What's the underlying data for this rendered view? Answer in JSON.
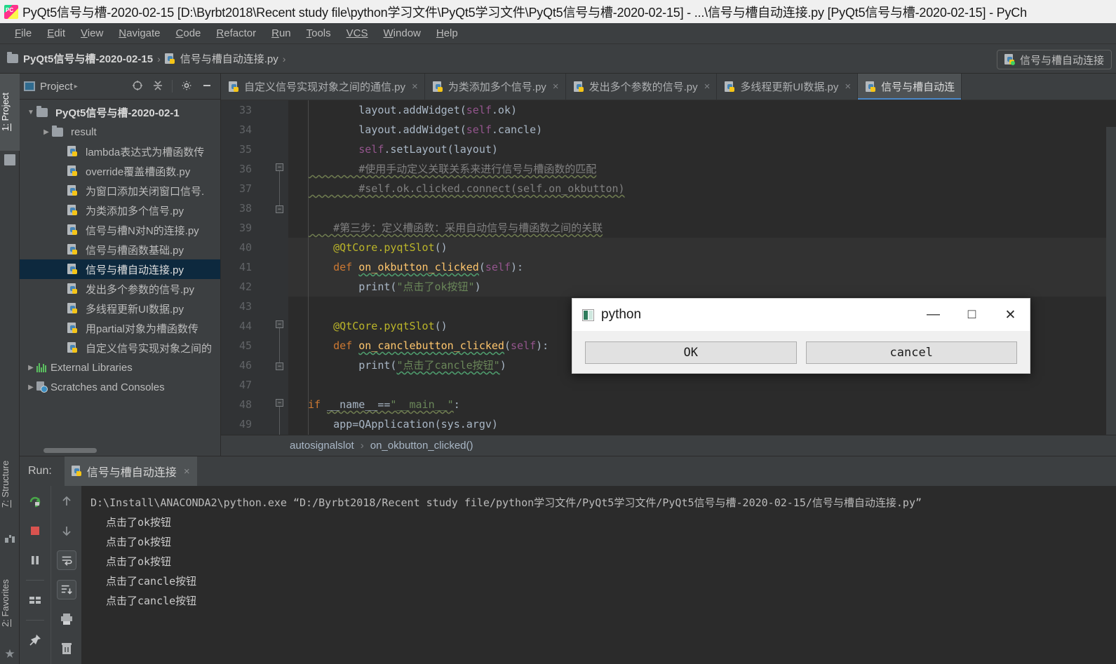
{
  "window": {
    "title": "PyQt5信号与槽-2020-02-15 [D:\\Byrbt2018\\Recent study file\\python学习文件\\PyQt5学习文件\\PyQt5信号与槽-2020-02-15] - ...\\信号与槽自动连接.py [PyQt5信号与槽-2020-02-15] - PyCh",
    "app_icon": "pycharm-logo-icon"
  },
  "menubar": {
    "items": [
      {
        "pre": "F",
        "rest": "ile"
      },
      {
        "pre": "E",
        "rest": "dit"
      },
      {
        "pre": "V",
        "rest": "iew"
      },
      {
        "pre": "N",
        "rest": "avigate"
      },
      {
        "pre": "C",
        "rest": "ode"
      },
      {
        "pre": "R",
        "rest": "efactor"
      },
      {
        "pre": "R",
        "rest": "un"
      },
      {
        "pre": "T",
        "rest": "ools"
      },
      {
        "pre": "VCS",
        "rest": ""
      },
      {
        "pre": "W",
        "rest": "indow"
      },
      {
        "pre": "H",
        "rest": "elp"
      }
    ]
  },
  "navbar": {
    "crumbs": [
      "PyQt5信号与槽-2020-02-15",
      "信号与槽自动连接.py"
    ],
    "separator": "›",
    "run_config": "信号与槽自动连接"
  },
  "left_strip": {
    "project_tab": {
      "num": "1:",
      "label": " Project"
    },
    "structure_tab": {
      "num": "7:",
      "label": " Structure"
    },
    "favorites_tab": {
      "num": "2:",
      "label": " Favorites"
    }
  },
  "project_panel": {
    "title": "Project",
    "caret": "▸",
    "tools": [
      "locate-icon",
      "collapse-all-icon",
      "gear-icon",
      "hide-icon"
    ],
    "tree": [
      {
        "indent": 0,
        "twisty": "▼",
        "icon": "folder",
        "label": "PyQt5信号与槽-2020-02-1",
        "root": true,
        "selected": false
      },
      {
        "indent": 1,
        "twisty": "▶",
        "icon": "folder",
        "label": "result",
        "root": false,
        "selected": false
      },
      {
        "indent": 2,
        "twisty": "",
        "icon": "py",
        "label": "lambda表达式为槽函数传",
        "root": false,
        "selected": false
      },
      {
        "indent": 2,
        "twisty": "",
        "icon": "py",
        "label": "override覆盖槽函数.py",
        "root": false,
        "selected": false
      },
      {
        "indent": 2,
        "twisty": "",
        "icon": "py",
        "label": "为窗口添加关闭窗口信号.",
        "root": false,
        "selected": false
      },
      {
        "indent": 2,
        "twisty": "",
        "icon": "py",
        "label": "为类添加多个信号.py",
        "root": false,
        "selected": false
      },
      {
        "indent": 2,
        "twisty": "",
        "icon": "py",
        "label": "信号与槽N对N的连接.py",
        "root": false,
        "selected": false
      },
      {
        "indent": 2,
        "twisty": "",
        "icon": "py",
        "label": "信号与槽函数基础.py",
        "root": false,
        "selected": false
      },
      {
        "indent": 2,
        "twisty": "",
        "icon": "py",
        "label": "信号与槽自动连接.py",
        "root": false,
        "selected": true
      },
      {
        "indent": 2,
        "twisty": "",
        "icon": "py",
        "label": "发出多个参数的信号.py",
        "root": false,
        "selected": false
      },
      {
        "indent": 2,
        "twisty": "",
        "icon": "py",
        "label": "多线程更新UI数据.py",
        "root": false,
        "selected": false
      },
      {
        "indent": 2,
        "twisty": "",
        "icon": "py",
        "label": "用partial对象为槽函数传",
        "root": false,
        "selected": false
      },
      {
        "indent": 2,
        "twisty": "",
        "icon": "py",
        "label": "自定义信号实现对象之间的",
        "root": false,
        "selected": false
      },
      {
        "indent": 0,
        "twisty": "▶",
        "icon": "lib",
        "label": "External Libraries",
        "root": false,
        "selected": false
      },
      {
        "indent": 0,
        "twisty": "▶",
        "icon": "scratch",
        "label": "Scratches and Consoles",
        "root": false,
        "selected": false
      }
    ]
  },
  "editor": {
    "tabs": [
      {
        "label": "自定义信号实现对象之间的通信.py",
        "active": false,
        "close": "×"
      },
      {
        "label": "为类添加多个信号.py",
        "active": false,
        "close": "×"
      },
      {
        "label": "发出多个参数的信号.py",
        "active": false,
        "close": "×"
      },
      {
        "label": "多线程更新UI数据.py",
        "active": false,
        "close": "×"
      },
      {
        "label": "信号与槽自动连",
        "active": true,
        "close": ""
      }
    ],
    "line_numbers": [
      "33",
      "34",
      "35",
      "36",
      "37",
      "38",
      "39",
      "40",
      "41",
      "42",
      "43",
      "44",
      "45",
      "46",
      "47",
      "48",
      "49"
    ],
    "breadcrumb": {
      "left": "autosignalslot",
      "sep": "›",
      "right": "on_okbutton_clicked()"
    }
  },
  "code": {
    "lines": [
      {
        "n": "33",
        "segs": [
          {
            "t": "        layout.addWidget(",
            "c": "t-txt"
          },
          {
            "t": "self",
            "c": "t-self"
          },
          {
            "t": ".ok)",
            "c": "t-txt"
          }
        ]
      },
      {
        "n": "34",
        "segs": [
          {
            "t": "        layout.addWidget(",
            "c": "t-txt"
          },
          {
            "t": "self",
            "c": "t-self"
          },
          {
            "t": ".cancle)",
            "c": "t-txt"
          }
        ]
      },
      {
        "n": "35",
        "segs": [
          {
            "t": "        ",
            "c": "t-txt"
          },
          {
            "t": "self",
            "c": "t-self"
          },
          {
            "t": ".setLayout(layout)",
            "c": "t-txt"
          }
        ]
      },
      {
        "n": "36",
        "segs": [
          {
            "t": "        #使用手动定义关联关系来进行信号与槽函数的匹配",
            "c": "t-cmt squig"
          }
        ]
      },
      {
        "n": "37",
        "segs": [
          {
            "t": "        #self.ok.clicked.connect(self.on_okbutton)",
            "c": "t-cmt squig"
          }
        ]
      },
      {
        "n": "38",
        "segs": []
      },
      {
        "n": "39",
        "segs": [
          {
            "t": "    #第三步：定义槽函数：采用自动信号与槽函数之间的关联",
            "c": "t-cmt squig"
          }
        ]
      },
      {
        "n": "40",
        "segs": [
          {
            "t": "    @QtCore.pyqtSlot",
            "c": "t-dec"
          },
          {
            "t": "()",
            "c": "t-txt"
          }
        ]
      },
      {
        "n": "41",
        "segs": [
          {
            "t": "    def ",
            "c": "t-def"
          },
          {
            "t": "on_okbutton_clicked",
            "c": "t-fn squig-g"
          },
          {
            "t": "(",
            "c": "t-txt"
          },
          {
            "t": "self",
            "c": "t-self"
          },
          {
            "t": "):",
            "c": "t-txt"
          }
        ]
      },
      {
        "n": "42",
        "segs": [
          {
            "t": "        print(",
            "c": "t-txt"
          },
          {
            "t": "\"点击了ok按钮\"",
            "c": "t-str"
          },
          {
            "t": ")",
            "c": "t-txt"
          }
        ]
      },
      {
        "n": "43",
        "segs": []
      },
      {
        "n": "44",
        "segs": [
          {
            "t": "    @QtCore.pyqtSlot",
            "c": "t-dec"
          },
          {
            "t": "()",
            "c": "t-txt"
          }
        ]
      },
      {
        "n": "45",
        "segs": [
          {
            "t": "    def ",
            "c": "t-def"
          },
          {
            "t": "on_canclebutton_clicked",
            "c": "t-fn squig-g"
          },
          {
            "t": "(",
            "c": "t-txt"
          },
          {
            "t": "self",
            "c": "t-self"
          },
          {
            "t": "):",
            "c": "t-txt"
          }
        ]
      },
      {
        "n": "46",
        "segs": [
          {
            "t": "        print(",
            "c": "t-txt"
          },
          {
            "t": "\"点击了cancle按钮\"",
            "c": "t-str squig-g"
          },
          {
            "t": ")",
            "c": "t-txt"
          }
        ]
      },
      {
        "n": "47",
        "segs": []
      },
      {
        "n": "48",
        "segs": [
          {
            "t": "if ",
            "c": "t-kw"
          },
          {
            "t": "__name__==",
            "c": "t-txt squig"
          },
          {
            "t": "\"__main__\"",
            "c": "t-str squig"
          },
          {
            "t": ":",
            "c": "t-txt"
          }
        ]
      },
      {
        "n": "49",
        "segs": [
          {
            "t": "    app=QApplication(sys.argv)",
            "c": "t-txt"
          }
        ]
      }
    ]
  },
  "dialog": {
    "title": "python",
    "icon": "python-window-icon",
    "minimize": "—",
    "maximize": "□",
    "close": "✕",
    "buttons": [
      {
        "label": "OK",
        "name": "ok-button"
      },
      {
        "label": "cancel",
        "name": "cancel-button"
      }
    ]
  },
  "run_panel": {
    "label": "Run:",
    "tab_label": "信号与槽自动连接",
    "tab_close": "×",
    "toolbar_left": [
      "rerun-icon",
      "stop-icon",
      "pause-icon",
      "layout-icon",
      "pin-icon"
    ],
    "toolbar_right": [
      "up-arrow-icon",
      "down-arrow-icon",
      "soft-wrap-icon",
      "scroll-to-end-icon",
      "print-icon",
      "clear-all-icon"
    ],
    "console": [
      {
        "type": "cmd",
        "text": "D:\\Install\\ANACONDA2\\python.exe “D:/Byrbt2018/Recent study file/python学习文件/PyQt5学习文件/PyQt5信号与槽-2020-02-15/信号与槽自动连接.py”"
      },
      {
        "type": "out",
        "text": "点击了ok按钮"
      },
      {
        "type": "out",
        "text": "点击了ok按钮"
      },
      {
        "type": "out",
        "text": "点击了ok按钮"
      },
      {
        "type": "out",
        "text": "点击了cancle按钮"
      },
      {
        "type": "out",
        "text": "点击了cancle按钮"
      }
    ]
  },
  "colors": {
    "ide_bg": "#3c3f41",
    "editor_bg": "#2b2b2b",
    "selection": "#0d293e",
    "accent": "#4a88c7",
    "keyword": "#cc7832",
    "string": "#6a8759",
    "function": "#ffc66d",
    "decorator": "#bbb529",
    "self": "#94558d",
    "comment": "#808080"
  }
}
